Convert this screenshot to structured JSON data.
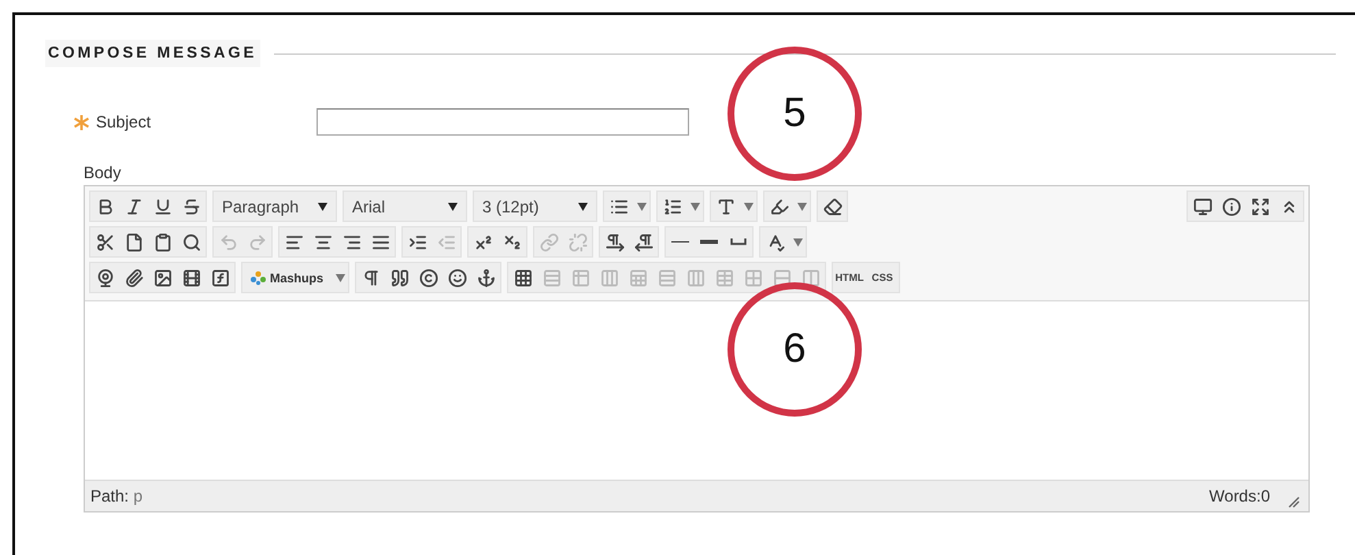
{
  "section": {
    "title": "COMPOSE MESSAGE"
  },
  "subject": {
    "label": "Subject",
    "required": true
  },
  "body": {
    "label": "Body"
  },
  "toolbar": {
    "rows": [
      {
        "groups": [
          {
            "items": [
              {
                "kind": "icon",
                "disabled": false
              },
              {
                "kind": "icon",
                "disabled": false
              },
              {
                "kind": "icon",
                "disabled": false
              },
              {
                "kind": "icon",
                "disabled": false
              }
            ]
          },
          {
            "items": [
              {
                "kind": "select",
                "label": "Paragraph"
              }
            ]
          },
          {
            "items": [
              {
                "kind": "select",
                "label": "Arial"
              }
            ]
          },
          {
            "items": [
              {
                "kind": "select",
                "label": "3 (12pt)"
              }
            ]
          },
          {
            "items": [
              {
                "kind": "split",
                "disabled": false
              }
            ]
          },
          {
            "items": [
              {
                "kind": "split",
                "disabled": false
              }
            ]
          },
          {
            "items": [
              {
                "kind": "split",
                "disabled": false
              }
            ]
          },
          {
            "items": [
              {
                "kind": "split",
                "disabled": false
              }
            ]
          },
          {
            "items": [
              {
                "kind": "icon",
                "disabled": false
              }
            ]
          }
        ],
        "end_groups": [
          {
            "items": [
              {
                "kind": "icon",
                "disabled": false
              },
              {
                "kind": "icon",
                "disabled": false
              },
              {
                "kind": "icon",
                "disabled": false
              },
              {
                "kind": "icon",
                "disabled": false
              }
            ]
          }
        ]
      },
      {
        "groups": [
          {
            "items": [
              {
                "kind": "icon",
                "disabled": false
              },
              {
                "kind": "icon",
                "disabled": false
              },
              {
                "kind": "icon",
                "disabled": false
              },
              {
                "kind": "icon",
                "disabled": false
              }
            ]
          },
          {
            "items": [
              {
                "kind": "icon",
                "disabled": true
              },
              {
                "kind": "icon",
                "disabled": true
              }
            ]
          },
          {
            "items": [
              {
                "kind": "icon",
                "disabled": false
              },
              {
                "kind": "icon",
                "disabled": false
              },
              {
                "kind": "icon",
                "disabled": false
              },
              {
                "kind": "icon",
                "disabled": false
              }
            ]
          },
          {
            "items": [
              {
                "kind": "icon",
                "disabled": false
              },
              {
                "kind": "icon",
                "disabled": true
              }
            ]
          },
          {
            "items": [
              {
                "kind": "icon",
                "disabled": false
              },
              {
                "kind": "icon",
                "disabled": false
              }
            ]
          },
          {
            "items": [
              {
                "kind": "icon",
                "disabled": true
              },
              {
                "kind": "icon",
                "disabled": true
              }
            ]
          },
          {
            "items": [
              {
                "kind": "icon",
                "disabled": false
              },
              {
                "kind": "icon",
                "disabled": false
              }
            ]
          },
          {
            "items": [
              {
                "kind": "icon",
                "disabled": false
              },
              {
                "kind": "icon",
                "disabled": false
              },
              {
                "kind": "icon",
                "disabled": false
              }
            ]
          },
          {
            "items": [
              {
                "kind": "split",
                "disabled": false
              }
            ]
          }
        ]
      },
      {
        "groups": [
          {
            "items": [
              {
                "kind": "icon",
                "disabled": false
              },
              {
                "kind": "icon",
                "disabled": false
              },
              {
                "kind": "icon",
                "disabled": false
              },
              {
                "kind": "icon",
                "disabled": false
              },
              {
                "kind": "icon",
                "disabled": false
              }
            ]
          },
          {
            "items": [
              {
                "kind": "mashup",
                "label": "Mashups"
              }
            ]
          },
          {
            "items": [
              {
                "kind": "icon",
                "disabled": false
              },
              {
                "kind": "icon",
                "disabled": false
              },
              {
                "kind": "icon",
                "disabled": false
              },
              {
                "kind": "icon",
                "disabled": false
              },
              {
                "kind": "icon",
                "disabled": false
              }
            ]
          },
          {
            "items": [
              {
                "kind": "icon",
                "disabled": false
              },
              {
                "kind": "icon",
                "disabled": true
              },
              {
                "kind": "icon",
                "disabled": true
              },
              {
                "kind": "icon",
                "disabled": true
              },
              {
                "kind": "icon",
                "disabled": true
              },
              {
                "kind": "icon",
                "disabled": true
              },
              {
                "kind": "icon",
                "disabled": true
              },
              {
                "kind": "icon",
                "disabled": true
              },
              {
                "kind": "icon",
                "disabled": true
              },
              {
                "kind": "icon",
                "disabled": true
              },
              {
                "kind": "icon",
                "disabled": true
              }
            ]
          },
          {
            "items": [
              {
                "kind": "text",
                "label": "HTML"
              },
              {
                "kind": "text",
                "label": "CSS"
              }
            ]
          }
        ]
      }
    ]
  },
  "status_bar": {
    "path_label": "Path:",
    "path": "p",
    "words": "Words:0"
  },
  "callouts": [
    {
      "label": "5"
    },
    {
      "label": "6"
    }
  ]
}
